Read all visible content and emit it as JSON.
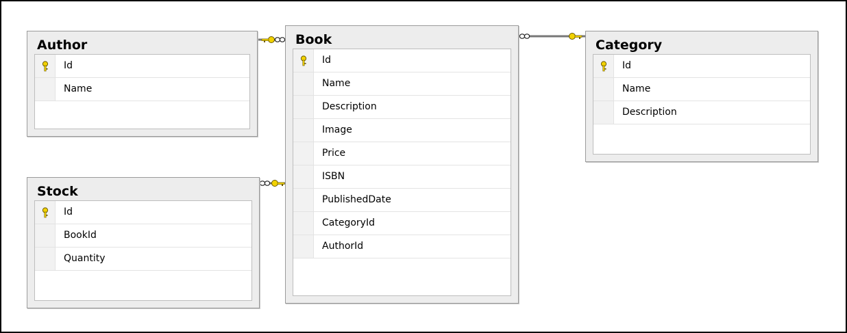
{
  "colors": {
    "table_background": "#ededed",
    "table_border": "#9a9a9a",
    "grid_background": "#ffffff",
    "key_icon": "#f2d200",
    "connector_line": "#777777"
  },
  "tables": {
    "author": {
      "title": "Author",
      "columns": [
        {
          "name": "Id",
          "primary_key": true
        },
        {
          "name": "Name",
          "primary_key": false
        }
      ]
    },
    "stock": {
      "title": "Stock",
      "columns": [
        {
          "name": "Id",
          "primary_key": true
        },
        {
          "name": "BookId",
          "primary_key": false
        },
        {
          "name": "Quantity",
          "primary_key": false
        }
      ]
    },
    "book": {
      "title": "Book",
      "columns": [
        {
          "name": "Id",
          "primary_key": true
        },
        {
          "name": "Name",
          "primary_key": false
        },
        {
          "name": "Description",
          "primary_key": false
        },
        {
          "name": "Image",
          "primary_key": false
        },
        {
          "name": "Price",
          "primary_key": false
        },
        {
          "name": "ISBN",
          "primary_key": false
        },
        {
          "name": "PublishedDate",
          "primary_key": false
        },
        {
          "name": "CategoryId",
          "primary_key": false
        },
        {
          "name": "AuthorId",
          "primary_key": false
        }
      ]
    },
    "category": {
      "title": "Category",
      "columns": [
        {
          "name": "Id",
          "primary_key": true
        },
        {
          "name": "Name",
          "primary_key": false
        },
        {
          "name": "Description",
          "primary_key": false
        }
      ]
    }
  },
  "relationships": [
    {
      "one_side": "Author",
      "many_side": "Book"
    },
    {
      "one_side": "Book",
      "many_side": "Stock"
    },
    {
      "one_side": "Category",
      "many_side": "Book"
    }
  ],
  "icons": {
    "primary_key": "key-icon",
    "one_end": "key-icon",
    "many_end": "infinity-icon"
  }
}
